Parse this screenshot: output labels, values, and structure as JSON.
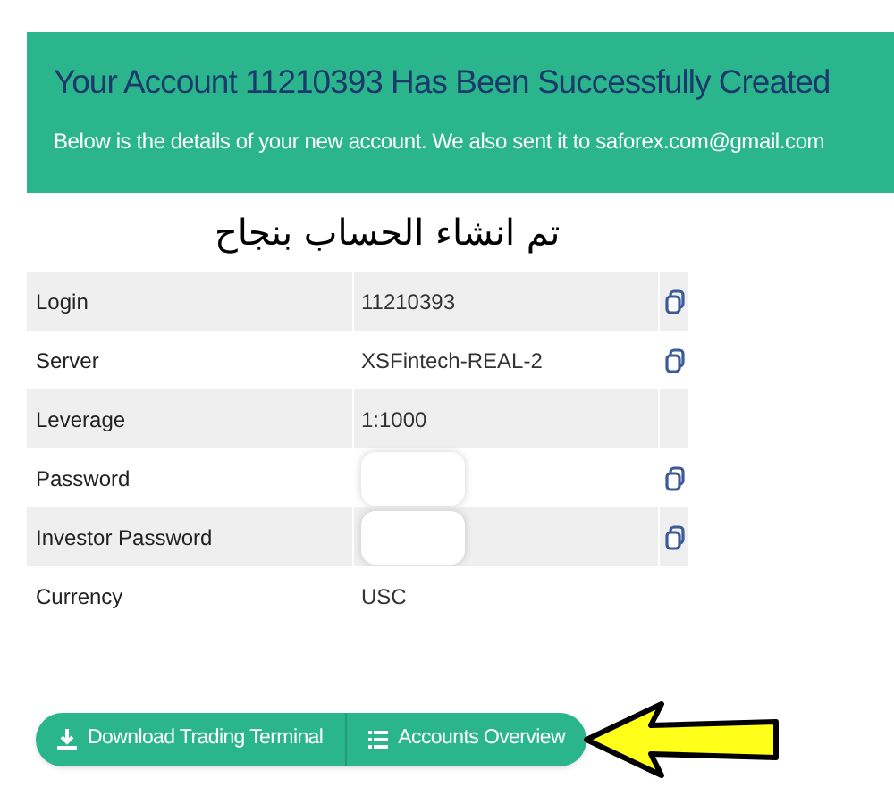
{
  "banner": {
    "title": "Your Account 11210393 Has Been Successfully Created",
    "subtitle": "Below is the details of your new account. We also sent it to saforex.com@gmail.com"
  },
  "caption": "تم انشاء الحساب بنجاح",
  "details": [
    {
      "label": "Login",
      "value": "11210393",
      "copyable": true,
      "redacted": false
    },
    {
      "label": "Server",
      "value": "XSFintech-REAL-2",
      "copyable": true,
      "redacted": false
    },
    {
      "label": "Leverage",
      "value": "1:1000",
      "copyable": false,
      "redacted": false
    },
    {
      "label": "Password",
      "copyable": true,
      "redacted": true
    },
    {
      "label": "Investor Password",
      "copyable": true,
      "redacted": true
    },
    {
      "label": "Currency",
      "value": "USC",
      "copyable": false,
      "redacted": false
    }
  ],
  "buttons": [
    {
      "label": "Download Trading Terminal",
      "kind": "download"
    },
    {
      "label": "Accounts Overview",
      "kind": "list"
    }
  ],
  "pointer_arrow": true
}
